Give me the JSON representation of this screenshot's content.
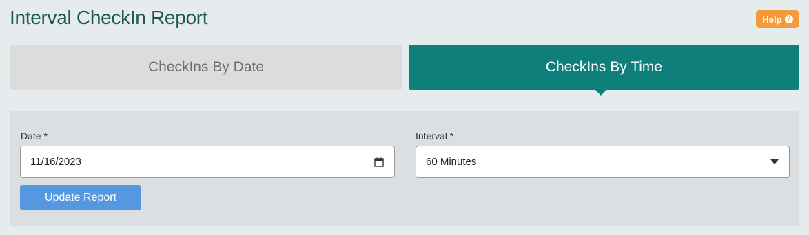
{
  "page": {
    "title": "Interval CheckIn Report",
    "help_label": "Help",
    "help_icon": "question-circle-icon"
  },
  "tabs": [
    {
      "label": "CheckIns By Date",
      "active": false
    },
    {
      "label": "CheckIns By Time",
      "active": true
    }
  ],
  "form": {
    "date_label": "Date *",
    "date_value": "11/16/2023",
    "interval_label": "Interval *",
    "interval_value": "60 Minutes",
    "update_button": "Update Report"
  },
  "colors": {
    "title": "#1b5a4f",
    "help": "#f39a3a",
    "active_tab": "#0f7f7c",
    "inactive_tab": "#dcdcdc",
    "button": "#5598e0"
  }
}
